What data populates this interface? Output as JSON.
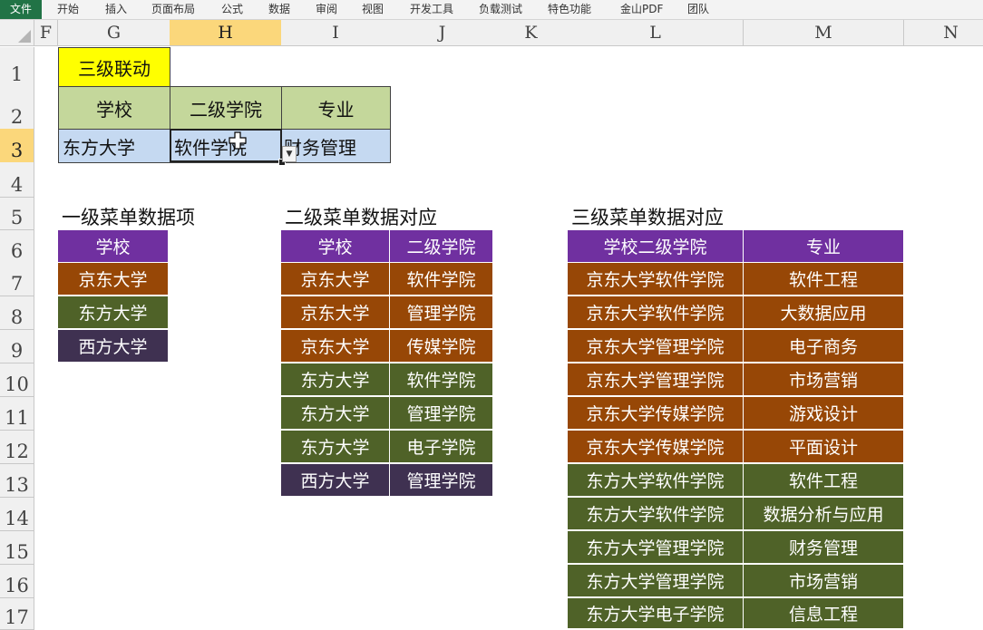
{
  "ribbon": {
    "tabs": [
      "文件",
      "开始",
      "插入",
      "页面布局",
      "公式",
      "数据",
      "审阅",
      "视图",
      "开发工具",
      "负载测试",
      "特色功能",
      "金山PDF",
      "团队"
    ]
  },
  "columns": [
    "F",
    "G",
    "H",
    "I",
    "J",
    "K",
    "L",
    "M",
    "N"
  ],
  "rows": [
    "1",
    "2",
    "3",
    "4",
    "5",
    "6",
    "7",
    "8",
    "9",
    "10",
    "11",
    "12",
    "13",
    "14",
    "15",
    "16",
    "17"
  ],
  "selected": {
    "column": "H",
    "row": "3"
  },
  "colors": {
    "purple": "#7030a0",
    "brown": "#974706",
    "green": "#4f6228",
    "dark_purple": "#3f3151",
    "yellow": "#ffff00",
    "light_green": "#c4d79b",
    "light_blue": "#c5d9f1"
  },
  "top_block": {
    "title": "三级联动",
    "headers": [
      "学校",
      "二级学院",
      "专业"
    ],
    "values": [
      "东方大学",
      "软件学院",
      "财务管理"
    ]
  },
  "level1": {
    "title": "一级菜单数据项",
    "header": "学校",
    "items": [
      {
        "text": "京东大学",
        "color": "brown"
      },
      {
        "text": "东方大学",
        "color": "green"
      },
      {
        "text": "西方大学",
        "color": "dark_purple"
      }
    ]
  },
  "level2": {
    "title": "二级菜单数据对应",
    "headers": [
      "学校",
      "二级学院"
    ],
    "rows": [
      {
        "school": "京东大学",
        "college": "软件学院",
        "color": "brown"
      },
      {
        "school": "京东大学",
        "college": "管理学院",
        "color": "brown"
      },
      {
        "school": "京东大学",
        "college": "传媒学院",
        "color": "brown"
      },
      {
        "school": "东方大学",
        "college": "软件学院",
        "color": "green"
      },
      {
        "school": "东方大学",
        "college": "管理学院",
        "color": "green"
      },
      {
        "school": "东方大学",
        "college": "电子学院",
        "color": "green"
      },
      {
        "school": "西方大学",
        "college": "管理学院",
        "color": "dark_purple"
      }
    ]
  },
  "level3": {
    "title": "三级菜单数据对应",
    "headers": [
      "学校二级学院",
      "专业"
    ],
    "rows": [
      {
        "key": "京东大学软件学院",
        "major": "软件工程",
        "color": "brown"
      },
      {
        "key": "京东大学软件学院",
        "major": "大数据应用",
        "color": "brown"
      },
      {
        "key": "京东大学管理学院",
        "major": "电子商务",
        "color": "brown"
      },
      {
        "key": "京东大学管理学院",
        "major": "市场营销",
        "color": "brown"
      },
      {
        "key": "京东大学传媒学院",
        "major": "游戏设计",
        "color": "brown"
      },
      {
        "key": "京东大学传媒学院",
        "major": "平面设计",
        "color": "brown"
      },
      {
        "key": "东方大学软件学院",
        "major": "软件工程",
        "color": "green"
      },
      {
        "key": "东方大学软件学院",
        "major": "数据分析与应用",
        "color": "green"
      },
      {
        "key": "东方大学管理学院",
        "major": "财务管理",
        "color": "green"
      },
      {
        "key": "东方大学管理学院",
        "major": "市场营销",
        "color": "green"
      },
      {
        "key": "东方大学电子学院",
        "major": "信息工程",
        "color": "green"
      }
    ]
  },
  "icons": {
    "dropdown": "dropdown-arrow-icon",
    "cursor": "cell-cursor-icon",
    "select_all": "select-all-icon"
  }
}
